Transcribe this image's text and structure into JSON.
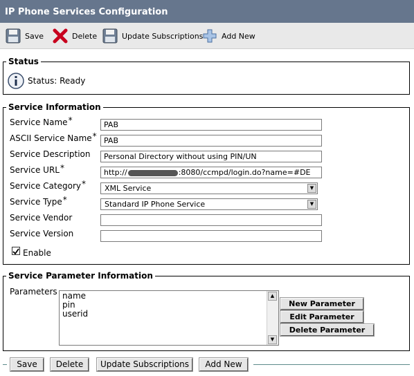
{
  "window": {
    "title": "IP Phone Services Configuration"
  },
  "toolbar": {
    "save_label": "Save",
    "delete_label": "Delete",
    "update_label": "Update Subscriptions",
    "addnew_label": "Add New"
  },
  "status": {
    "header": "Status",
    "text": "Status: Ready",
    "icon": "info-icon"
  },
  "service_info": {
    "header": "Service Information",
    "required_mark": "*",
    "fields": {
      "name": {
        "label": "Service Name",
        "value": "PAB"
      },
      "ascii_name": {
        "label": "ASCII Service Name",
        "value": "PAB"
      },
      "description": {
        "label": "Service Description",
        "value": "Personal Directory without using PIN/UN"
      },
      "url": {
        "label": "Service URL",
        "prefix": "http://",
        "suffix": ":8080/ccmpd/login.do?name=#DE"
      },
      "category": {
        "label": "Service Category",
        "value": "XML Service"
      },
      "type": {
        "label": "Service Type",
        "value": "Standard IP Phone Service"
      },
      "vendor": {
        "label": "Service Vendor",
        "value": ""
      },
      "version": {
        "label": "Service Version",
        "value": ""
      }
    },
    "enable": {
      "label": "Enable",
      "checked": true
    }
  },
  "params": {
    "header": "Service Parameter Information",
    "label": "Parameters",
    "items": [
      "name",
      "pin",
      "userid"
    ],
    "new_button": "New Parameter",
    "edit_button": "Edit Parameter",
    "delete_button": "Delete Parameter"
  },
  "bottom": {
    "save_label": "Save",
    "delete_label": "Delete",
    "update_label": "Update Subscriptions",
    "addnew_label": "Add New"
  }
}
